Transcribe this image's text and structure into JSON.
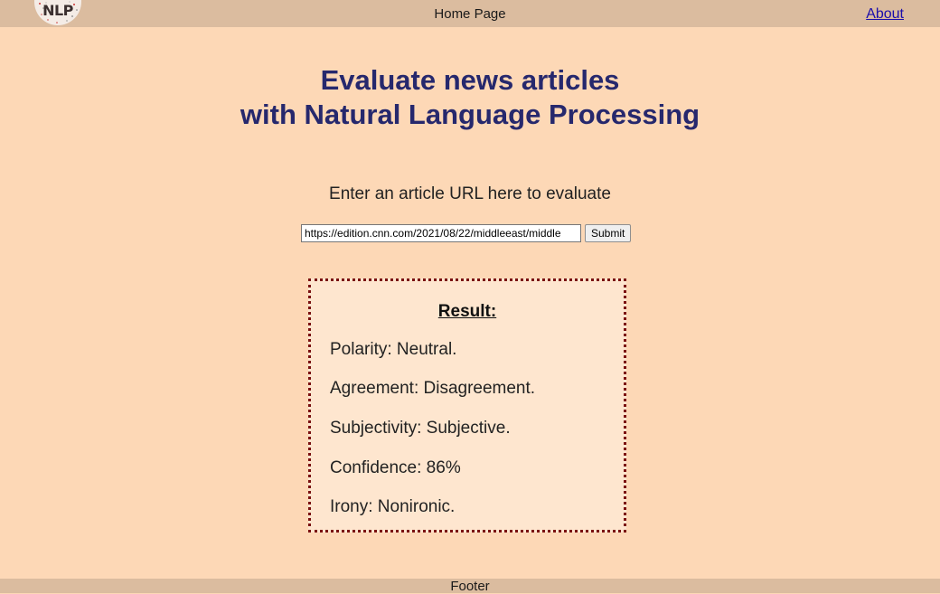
{
  "header": {
    "logo_text": "NLP",
    "page_title": "Home Page",
    "about_link": "About"
  },
  "main": {
    "headline_line1": "Evaluate news articles",
    "headline_line2": "with Natural Language Processing",
    "prompt": "Enter an article URL here to evaluate",
    "url_value": "https://edition.cnn.com/2021/08/22/middleeast/middle",
    "submit_label": "Submit"
  },
  "result": {
    "title": "Result:",
    "polarity": "Polarity: Neutral.",
    "agreement": "Agreement: Disagreement.",
    "subjectivity": "Subjectivity: Subjective.",
    "confidence": "Confidence: 86%",
    "irony": "Irony: Nonironic."
  },
  "footer": {
    "text": "Footer"
  },
  "colors": {
    "page_background": "#fdd8b6",
    "bar_background": "#dbbc9f",
    "headline": "#26286d",
    "result_border": "#7a1010",
    "result_background": "#fee6cf",
    "link": "#1a0dab"
  }
}
